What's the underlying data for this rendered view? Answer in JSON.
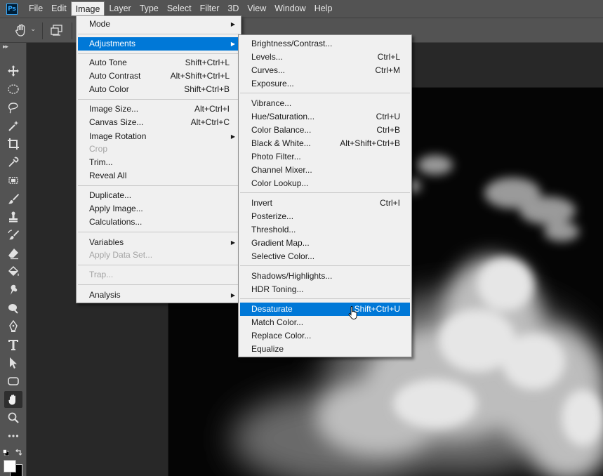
{
  "app": {
    "logo_text": "Ps",
    "menubar": [
      "File",
      "Edit",
      "Image",
      "Layer",
      "Type",
      "Select",
      "Filter",
      "3D",
      "View",
      "Window",
      "Help"
    ],
    "active_menu": "Image"
  },
  "image_menu": {
    "mode": {
      "label": "Mode"
    },
    "adjustments": {
      "label": "Adjustments"
    },
    "auto_tone": {
      "label": "Auto Tone",
      "shortcut": "Shift+Ctrl+L"
    },
    "auto_contrast": {
      "label": "Auto Contrast",
      "shortcut": "Alt+Shift+Ctrl+L"
    },
    "auto_color": {
      "label": "Auto Color",
      "shortcut": "Shift+Ctrl+B"
    },
    "image_size": {
      "label": "Image Size...",
      "shortcut": "Alt+Ctrl+I"
    },
    "canvas_size": {
      "label": "Canvas Size...",
      "shortcut": "Alt+Ctrl+C"
    },
    "image_rotation": {
      "label": "Image Rotation"
    },
    "crop": {
      "label": "Crop"
    },
    "trim": {
      "label": "Trim..."
    },
    "reveal_all": {
      "label": "Reveal All"
    },
    "duplicate": {
      "label": "Duplicate..."
    },
    "apply_image": {
      "label": "Apply Image..."
    },
    "calculations": {
      "label": "Calculations..."
    },
    "variables": {
      "label": "Variables"
    },
    "apply_data_set": {
      "label": "Apply Data Set..."
    },
    "trap": {
      "label": "Trap..."
    },
    "analysis": {
      "label": "Analysis"
    }
  },
  "adjust_menu": {
    "brightness": {
      "label": "Brightness/Contrast..."
    },
    "levels": {
      "label": "Levels...",
      "shortcut": "Ctrl+L"
    },
    "curves": {
      "label": "Curves...",
      "shortcut": "Ctrl+M"
    },
    "exposure": {
      "label": "Exposure..."
    },
    "vibrance": {
      "label": "Vibrance..."
    },
    "hue_saturation": {
      "label": "Hue/Saturation...",
      "shortcut": "Ctrl+U"
    },
    "color_balance": {
      "label": "Color Balance...",
      "shortcut": "Ctrl+B"
    },
    "black_white": {
      "label": "Black & White...",
      "shortcut": "Alt+Shift+Ctrl+B"
    },
    "photo_filter": {
      "label": "Photo Filter..."
    },
    "channel_mixer": {
      "label": "Channel Mixer..."
    },
    "color_lookup": {
      "label": "Color Lookup..."
    },
    "invert": {
      "label": "Invert",
      "shortcut": "Ctrl+I"
    },
    "posterize": {
      "label": "Posterize..."
    },
    "threshold": {
      "label": "Threshold..."
    },
    "gradient_map": {
      "label": "Gradient Map..."
    },
    "selective_color": {
      "label": "Selective Color..."
    },
    "shadows_highlights": {
      "label": "Shadows/Highlights..."
    },
    "hdr_toning": {
      "label": "HDR Toning..."
    },
    "desaturate": {
      "label": "Desaturate",
      "shortcut": "Shift+Ctrl+U"
    },
    "match_color": {
      "label": "Match Color..."
    },
    "replace_color": {
      "label": "Replace Color..."
    },
    "equalize": {
      "label": "Equalize"
    }
  },
  "tools": [
    "move-tool",
    "marquee-tool",
    "lasso-tool",
    "magic-wand-tool",
    "crop-tool",
    "eyedropper-tool",
    "healing-tool",
    "brush-tool",
    "stamp-tool",
    "history-brush-tool",
    "eraser-tool",
    "paint-bucket-tool",
    "smudge-tool",
    "dodge-tool",
    "pen-tool",
    "type-tool",
    "path-selection-tool",
    "rectangle-tool",
    "hand-tool",
    "zoom-tool",
    "more-tools"
  ],
  "selected_tool": "hand-tool",
  "colors": {
    "highlight": "#0078d7",
    "menu_bg": "#f0f0f0",
    "chrome": "#535353",
    "workspace": "#282828",
    "foreground_swatch": "#ffffff",
    "background_swatch": "#000000"
  }
}
